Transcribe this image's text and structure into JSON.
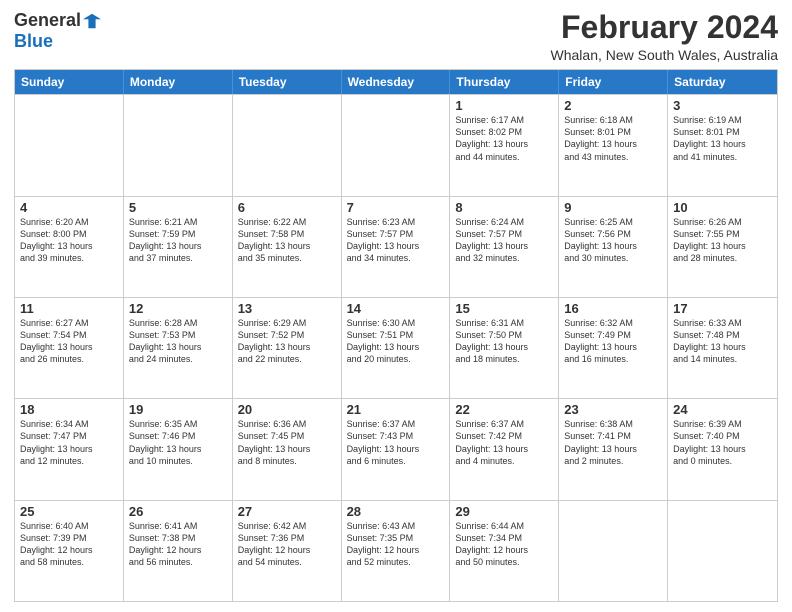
{
  "header": {
    "logo": {
      "general": "General",
      "blue": "Blue"
    },
    "title": "February 2024",
    "subtitle": "Whalan, New South Wales, Australia"
  },
  "calendar": {
    "days_of_week": [
      "Sunday",
      "Monday",
      "Tuesday",
      "Wednesday",
      "Thursday",
      "Friday",
      "Saturday"
    ],
    "rows": [
      [
        {
          "day": "",
          "info": "",
          "empty": true
        },
        {
          "day": "",
          "info": "",
          "empty": true
        },
        {
          "day": "",
          "info": "",
          "empty": true
        },
        {
          "day": "",
          "info": "",
          "empty": true
        },
        {
          "day": "1",
          "info": "Sunrise: 6:17 AM\nSunset: 8:02 PM\nDaylight: 13 hours\nand 44 minutes.",
          "empty": false
        },
        {
          "day": "2",
          "info": "Sunrise: 6:18 AM\nSunset: 8:01 PM\nDaylight: 13 hours\nand 43 minutes.",
          "empty": false
        },
        {
          "day": "3",
          "info": "Sunrise: 6:19 AM\nSunset: 8:01 PM\nDaylight: 13 hours\nand 41 minutes.",
          "empty": false
        }
      ],
      [
        {
          "day": "4",
          "info": "Sunrise: 6:20 AM\nSunset: 8:00 PM\nDaylight: 13 hours\nand 39 minutes.",
          "empty": false
        },
        {
          "day": "5",
          "info": "Sunrise: 6:21 AM\nSunset: 7:59 PM\nDaylight: 13 hours\nand 37 minutes.",
          "empty": false
        },
        {
          "day": "6",
          "info": "Sunrise: 6:22 AM\nSunset: 7:58 PM\nDaylight: 13 hours\nand 35 minutes.",
          "empty": false
        },
        {
          "day": "7",
          "info": "Sunrise: 6:23 AM\nSunset: 7:57 PM\nDaylight: 13 hours\nand 34 minutes.",
          "empty": false
        },
        {
          "day": "8",
          "info": "Sunrise: 6:24 AM\nSunset: 7:57 PM\nDaylight: 13 hours\nand 32 minutes.",
          "empty": false
        },
        {
          "day": "9",
          "info": "Sunrise: 6:25 AM\nSunset: 7:56 PM\nDaylight: 13 hours\nand 30 minutes.",
          "empty": false
        },
        {
          "day": "10",
          "info": "Sunrise: 6:26 AM\nSunset: 7:55 PM\nDaylight: 13 hours\nand 28 minutes.",
          "empty": false
        }
      ],
      [
        {
          "day": "11",
          "info": "Sunrise: 6:27 AM\nSunset: 7:54 PM\nDaylight: 13 hours\nand 26 minutes.",
          "empty": false
        },
        {
          "day": "12",
          "info": "Sunrise: 6:28 AM\nSunset: 7:53 PM\nDaylight: 13 hours\nand 24 minutes.",
          "empty": false
        },
        {
          "day": "13",
          "info": "Sunrise: 6:29 AM\nSunset: 7:52 PM\nDaylight: 13 hours\nand 22 minutes.",
          "empty": false
        },
        {
          "day": "14",
          "info": "Sunrise: 6:30 AM\nSunset: 7:51 PM\nDaylight: 13 hours\nand 20 minutes.",
          "empty": false
        },
        {
          "day": "15",
          "info": "Sunrise: 6:31 AM\nSunset: 7:50 PM\nDaylight: 13 hours\nand 18 minutes.",
          "empty": false
        },
        {
          "day": "16",
          "info": "Sunrise: 6:32 AM\nSunset: 7:49 PM\nDaylight: 13 hours\nand 16 minutes.",
          "empty": false
        },
        {
          "day": "17",
          "info": "Sunrise: 6:33 AM\nSunset: 7:48 PM\nDaylight: 13 hours\nand 14 minutes.",
          "empty": false
        }
      ],
      [
        {
          "day": "18",
          "info": "Sunrise: 6:34 AM\nSunset: 7:47 PM\nDaylight: 13 hours\nand 12 minutes.",
          "empty": false
        },
        {
          "day": "19",
          "info": "Sunrise: 6:35 AM\nSunset: 7:46 PM\nDaylight: 13 hours\nand 10 minutes.",
          "empty": false
        },
        {
          "day": "20",
          "info": "Sunrise: 6:36 AM\nSunset: 7:45 PM\nDaylight: 13 hours\nand 8 minutes.",
          "empty": false
        },
        {
          "day": "21",
          "info": "Sunrise: 6:37 AM\nSunset: 7:43 PM\nDaylight: 13 hours\nand 6 minutes.",
          "empty": false
        },
        {
          "day": "22",
          "info": "Sunrise: 6:37 AM\nSunset: 7:42 PM\nDaylight: 13 hours\nand 4 minutes.",
          "empty": false
        },
        {
          "day": "23",
          "info": "Sunrise: 6:38 AM\nSunset: 7:41 PM\nDaylight: 13 hours\nand 2 minutes.",
          "empty": false
        },
        {
          "day": "24",
          "info": "Sunrise: 6:39 AM\nSunset: 7:40 PM\nDaylight: 13 hours\nand 0 minutes.",
          "empty": false
        }
      ],
      [
        {
          "day": "25",
          "info": "Sunrise: 6:40 AM\nSunset: 7:39 PM\nDaylight: 12 hours\nand 58 minutes.",
          "empty": false
        },
        {
          "day": "26",
          "info": "Sunrise: 6:41 AM\nSunset: 7:38 PM\nDaylight: 12 hours\nand 56 minutes.",
          "empty": false
        },
        {
          "day": "27",
          "info": "Sunrise: 6:42 AM\nSunset: 7:36 PM\nDaylight: 12 hours\nand 54 minutes.",
          "empty": false
        },
        {
          "day": "28",
          "info": "Sunrise: 6:43 AM\nSunset: 7:35 PM\nDaylight: 12 hours\nand 52 minutes.",
          "empty": false
        },
        {
          "day": "29",
          "info": "Sunrise: 6:44 AM\nSunset: 7:34 PM\nDaylight: 12 hours\nand 50 minutes.",
          "empty": false
        },
        {
          "day": "",
          "info": "",
          "empty": true
        },
        {
          "day": "",
          "info": "",
          "empty": true
        }
      ]
    ]
  }
}
